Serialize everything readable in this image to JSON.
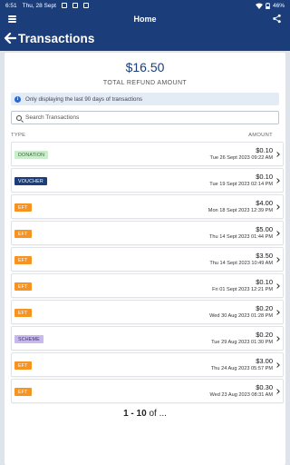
{
  "status_bar": {
    "time": "6:51",
    "date": "Thu, 28 Sept",
    "battery": "46%"
  },
  "top_bar": {
    "title": "Home"
  },
  "page": {
    "title": "Transactions"
  },
  "summary": {
    "total": "$16.50",
    "label": "TOTAL REFUND AMOUNT"
  },
  "info": {
    "text": "Only displaying the last 90 days of transactions"
  },
  "search": {
    "placeholder": "Search Transactions",
    "value": ""
  },
  "columns": {
    "type": "TYPE",
    "amount": "AMOUNT"
  },
  "transactions": [
    {
      "type": "DONATION",
      "amount": "$0.10",
      "date": "Tue 26 Sept 2023 09:22 AM"
    },
    {
      "type": "VOUCHER",
      "amount": "$0.10",
      "date": "Tue 19 Sept 2023 02:14 PM"
    },
    {
      "type": "EFT",
      "amount": "$4.00",
      "date": "Mon 18 Sept 2023 12:39 PM"
    },
    {
      "type": "EFT",
      "amount": "$5.00",
      "date": "Thu 14 Sept 2023 01:44 PM"
    },
    {
      "type": "EFT",
      "amount": "$3.50",
      "date": "Thu 14 Sept 2023 10:49 AM"
    },
    {
      "type": "EFT",
      "amount": "$0.10",
      "date": "Fri 01 Sept 2023 12:21 PM"
    },
    {
      "type": "EFT",
      "amount": "$0.20",
      "date": "Wed 30 Aug 2023 01:28 PM"
    },
    {
      "type": "SCHEME",
      "amount": "$0.20",
      "date": "Tue 29 Aug 2023 01:30 PM"
    },
    {
      "type": "EFT",
      "amount": "$3.00",
      "date": "Thu 24 Aug 2023 05:57 PM"
    },
    {
      "type": "EFT",
      "amount": "$0.30",
      "date": "Wed 23 Aug 2023 08:31 AM"
    }
  ],
  "badge_colors": {
    "DONATION": {
      "bg": "#cdeccd",
      "fg": "#2e6b2e"
    },
    "VOUCHER": {
      "bg": "#1b3e7b",
      "fg": "#ffffff"
    },
    "EFT": {
      "bg": "#f7931e",
      "fg": "#ffffff"
    },
    "SCHEME": {
      "bg": "#c9b8ec",
      "fg": "#3e2a6b"
    }
  },
  "pagination": {
    "range": "1 - 10",
    "of": "of ..."
  },
  "colors": {
    "primary": "#1b3e7b",
    "background": "#dfe3ea"
  }
}
